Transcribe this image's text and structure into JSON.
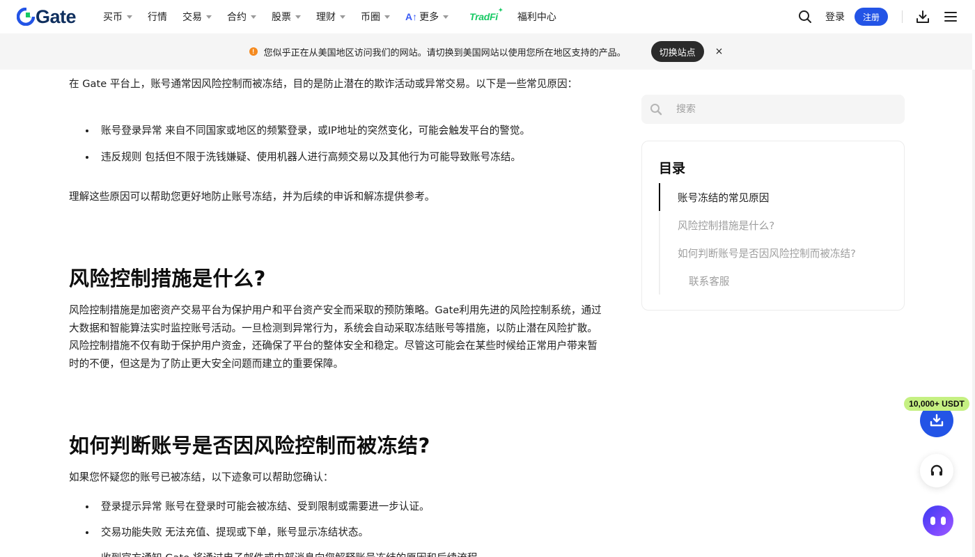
{
  "brand": {
    "name": "Gate",
    "color": "#0f2f5e",
    "accent": "#2354e6"
  },
  "nav": {
    "items": [
      {
        "label": "买币",
        "dropdown": true
      },
      {
        "label": "行情",
        "dropdown": false
      },
      {
        "label": "交易",
        "dropdown": true
      },
      {
        "label": "合约",
        "dropdown": true
      },
      {
        "label": "股票",
        "dropdown": true
      },
      {
        "label": "理财",
        "dropdown": true
      },
      {
        "label": "币圈",
        "dropdown": true
      }
    ],
    "more_label": "更多",
    "tradfi_label": "TradFi",
    "welfare_label": "福利中心",
    "login_label": "登录",
    "register_label": "注册"
  },
  "notice": {
    "text": "您似乎正在从美国地区访问我们的网站。请切换到美国网站以使用您所在地区支持的产品。",
    "switch_label": "切换站点",
    "close_label": "×"
  },
  "article": {
    "intro": "在 Gate 平台上，账号通常因风险控制而被冻结，目的是防止潜在的欺诈活动或异常交易。以下是一些常见原因：",
    "reasons": [
      "账号登录异常 来自不同国家或地区的频繁登录，或IP地址的突然变化，可能会触发平台的警觉。",
      "违反规则 包括但不限于洗钱嫌疑、使用机器人进行高频交易以及其他行为可能导致账号冻结。"
    ],
    "reasons_summary": "理解这些原因可以帮助您更好地防止账号冻结，并为后续的申诉和解冻提供参考。",
    "section2_title": "风险控制措施是什么?",
    "section2_body": "风险控制措施是加密资产交易平台为保护用户和平台资产安全而采取的预防策略。Gate利用先进的风险控制系统，通过大数据和智能算法实时监控账号活动。一旦检测到异常行为，系统会自动采取冻结账号等措施，以防止潜在风险扩散。风险控制措施不仅有助于保护用户资金，还确保了平台的整体安全和稳定。尽管这可能会在某些时候给正常用户带来暂时的不便，但这是为了防止更大安全问题而建立的重要保障。",
    "section3_title": "如何判断账号是否因风险控制而被冻结?",
    "section3_intro": "如果您怀疑您的账号已被冻结，以下迹象可以帮助您确认：",
    "signs": [
      "登录提示异常 账号在登录时可能会被冻结、受到限制或需要进一步认证。",
      "交易功能失败 无法充值、提现或下单，账号显示冻结状态。",
      "收到官方通知 Gate 将通过电子邮件或内部消息向您解释账号冻结的原因和后续流程。"
    ]
  },
  "sidebar": {
    "search_placeholder": "搜索",
    "toc_title": "目录",
    "toc_items": [
      {
        "label": "账号冻结的常见原因",
        "active": true
      },
      {
        "label": "风险控制措施是什么?",
        "active": false
      },
      {
        "label": "如何判断账号是否因风险控制而被冻结?",
        "active": false
      },
      {
        "label": "联系客服",
        "active": false
      }
    ]
  },
  "floating": {
    "promo_badge": "10,000+ USDT"
  }
}
